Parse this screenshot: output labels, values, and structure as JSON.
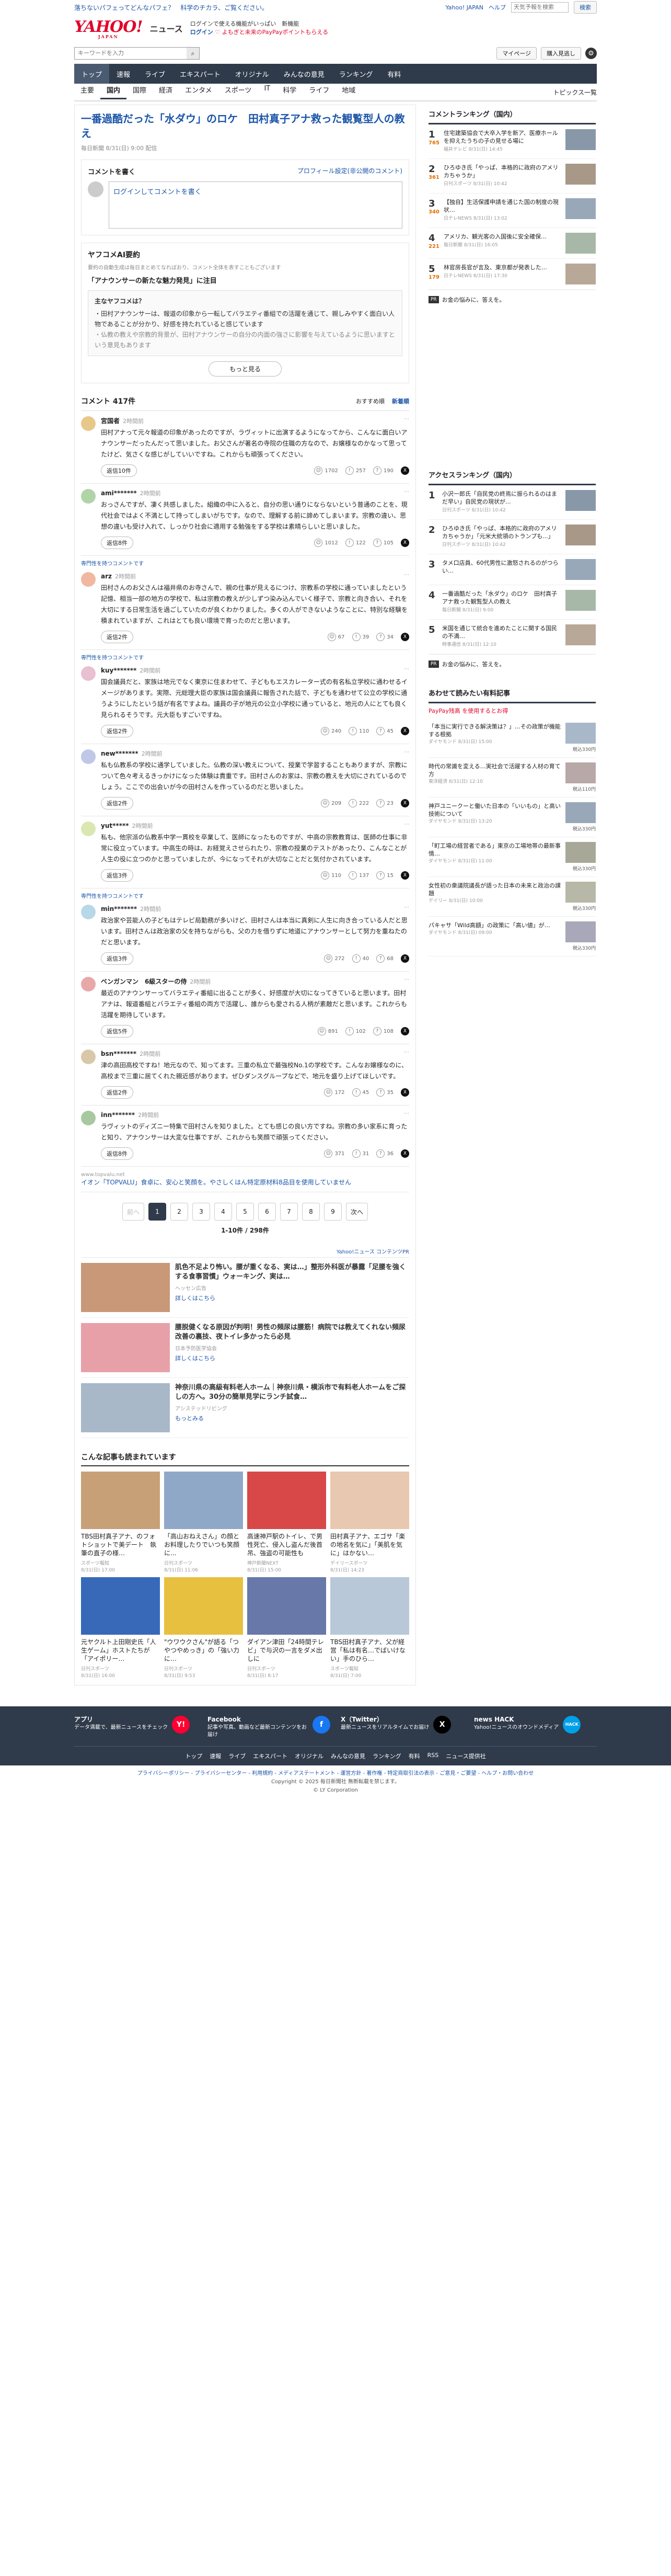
{
  "promo": {
    "left": "落ちないパフェってどんなパフェ？　科学のチカラ、ご覧ください。",
    "links": [
      "Yahoo! JAPAN",
      "ヘルプ"
    ],
    "search_placeholder": "天気予報を検索",
    "search_btn": "検索"
  },
  "header": {
    "logo": "YAHOO!",
    "logo_sub": "JAPAN",
    "news": "ニュース",
    "msg1": "ログインで使える機能がいっぱい　新機能",
    "msg2": "ログイン",
    "msg3": "♡ よもぎと未来のPayPayポイントもらえる"
  },
  "search": {
    "placeholder": "キーワードを入力",
    "mypage": "マイページ",
    "login": "購入見逃し"
  },
  "nav": [
    "トップ",
    "速報",
    "ライブ",
    "エキスパート",
    "オリジナル",
    "みんなの意見",
    "ランキング",
    "有料"
  ],
  "subnav": {
    "items": [
      "主要",
      "国内",
      "国際",
      "経済",
      "エンタメ",
      "スポーツ",
      "IT",
      "科学",
      "ライフ",
      "地域"
    ],
    "topics": "トピックス一覧"
  },
  "article": {
    "title": "一番過酷だった「水ダウ」のロケ　田村真子アナ救った観覧型人の教え",
    "meta": "毎日新聞 8/31(日) 9:00 配信"
  },
  "comment_box": {
    "title": "コメントを書く",
    "link": "プロフィール設定(非公開のコメント)",
    "input": "ログインしてコメントを書く"
  },
  "ai": {
    "title": "ヤフコメAI要約",
    "note": "要約の自動生成は毎日まとめてなればおり、コメント全体を表すこともございます",
    "quote": "「アナウンサーの新たな魅力発見」に注目",
    "q": "主なヤフコメは？",
    "p1": "・田村アナウンサーは、報道の印象から一転してバラエティ番組での活躍を通じて、親しみやすく面白い人物であることが分かり、好感を持たれていると感じています",
    "p2": "・仏教の教えや宗教的背景が、田村アナウンサーの自分の内面の強さに影響を与えているように思いますという意見もあります",
    "more": "もっと見る"
  },
  "comments_header": {
    "count": "コメント 417件",
    "sort1": "おすすめ順",
    "sort2": "新着順"
  },
  "comments": [
    {
      "user": "宮国者",
      "time": "2時間前",
      "text": "田村アナって元々報道の印象があったのですが、ラヴィットに出演するようになってから、こんなに面白いアナウンサーだったんだって思いました。お父さんが著名の寺院の住職の方なので、お嬢様なのかなって思ってたけど、気さくな感じがしていいですね。これからも頑張ってください。",
      "reply": "返信10件",
      "v1": "1702",
      "v2": "257",
      "v3": "190",
      "color": "#e8c88a"
    },
    {
      "user": "ami*******",
      "time": "2時間前",
      "text": "おっさんですが、凄く共感しました。組織の中に入ると、自分の思い通りにならないという普通のことを、現代社会ではよく不満として持ってしまいがちです。なので、理解する前に諦めてしまいます。宗教の違い、思想の違いも受け入れて、しっかり社会に適用する勉強をする学校は素晴らしいと思いました。",
      "reply": "返信8件",
      "v1": "1012",
      "v2": "122",
      "v3": "105",
      "color": "#b0d4a8"
    },
    {
      "user": "arz",
      "time": "2時間前",
      "text": "田村さんのお父さんは福井県のお寺さんで、親の仕事が見えるにつけ、宗教系の学校に通っていましたという記憶、相当一部の地方の学校で、私は宗教の教えが少しずつ染み込んでいく様子で、宗教と向き合い、それを大切にする日常生活を過ごしていたのが良くわかりました。多くの人ができないようなことに、特別な経験を積まれていますが、これはとても良い環境で育ったのだと思います。",
      "reply": "返信2件",
      "v1": "67",
      "v2": "39",
      "v3": "34",
      "color": "#f0b8a0",
      "expert": true
    },
    {
      "user": "kuy*******",
      "time": "2時間前",
      "text": "国会議員だと、家族は地元でなく東京に住まわせて、子どももエスカレーター式の有名私立学校に通わせるイメージがあります。実際、元総理大臣の家族は国会議員に報告された話で、子どもを通わせて公立の学校に通うようにしたという話が有名ですよね。議員の子が地元の公立小学校に通っていると、地元の人にとても良く見られるそうです。元大臣もすごいですね。",
      "reply": "返信2件",
      "v1": "240",
      "v2": "110",
      "v3": "45",
      "color": "#e8c0d0",
      "expert": true
    },
    {
      "user": "new*******",
      "time": "2時間前",
      "text": "私も仏教系の学校に通学していました。仏教の深い教えについて、授業で学習することもありますが、宗教について色々考えるきっかけになった体験は貴重です。田村さんのお家は、宗教の教えを大切にされているのでしょう。ここでの出会いが今の田村さんを作っているのだと思いました。",
      "reply": "返信2件",
      "v1": "209",
      "v2": "222",
      "v3": "23",
      "color": "#c0c8e8"
    },
    {
      "user": "yut*****",
      "time": "2時間前",
      "text": "私も、他宗派の仏教系中学一貫校を卒業して、医師になったものですが、中高の宗教教育は、医師の仕事に非常に役立っています。中高生の時は、お経覚えさせられたり、宗教の授業のテストがあったり、こんなことが人生の役に立つのかと思っていましたが、今になってそれが大切なことだと気付かされています。",
      "reply": "返信3件",
      "v1": "110",
      "v2": "137",
      "v3": "15",
      "color": "#d8e8b0"
    },
    {
      "user": "min*******",
      "time": "2時間前",
      "text": "政治家や芸能人の子どもはテレビ局勤務が多いけど、田村さんは本当に真剣に人生に向き合っている人だと思います。田村さんは政治家の父を持ちながらも、父の力を借りずに地道にアナウンサーとして努力を重ねたのだと思います。",
      "reply": "返信3件",
      "v1": "272",
      "v2": "40",
      "v3": "68",
      "color": "#b8d8e8",
      "expert": true
    },
    {
      "user": "ベンガンマン　6級スターの侍",
      "time": "2時間前",
      "text": "最近のアナウンサーってバラエティ番組に出ることが多く、好感度が大切になってきていると思います。田村アナは、報道番組とバラエティ番組の両方で活躍し、誰からも愛される人柄が素敵だと思います。これからも活躍を期待しています。",
      "reply": "返信5件",
      "v1": "891",
      "v2": "102",
      "v3": "108",
      "color": "#e8a8a8"
    },
    {
      "user": "bsn*******",
      "time": "2時間前",
      "text": "津の高田高校ですね！地元なので、知ってます。三重の私立で最強校No.1の学校です。こんなお嬢様なのに、高校まで三重に居てくれた親近感があります。ぜひダンスグループなどで、地元を盛り上げてほしいです。",
      "reply": "返信2件",
      "v1": "172",
      "v2": "45",
      "v3": "35",
      "color": "#d8c8a8"
    },
    {
      "user": "inn*******",
      "time": "2時間前",
      "text": "ラヴィットのディズニー特集で田村さんを知りました。とても感じの良い方ですね。宗教の多い家系に育ったと知り、アナウンサーは大変な仕事ですが、これからも笑顔で頑張ってください。",
      "reply": "返信8件",
      "v1": "371",
      "v2": "31",
      "v3": "36",
      "color": "#a8c8a0"
    }
  ],
  "expert_label": "専門性を持つコメントです",
  "ad_line": {
    "url": "www.topvalu.net",
    "text": "イオン「TOPVALU」食卓に、安心と笑顔を。やさしくはん特定原材料8品目を使用していません"
  },
  "pager": {
    "prev": "前へ",
    "pages": [
      "1",
      "2",
      "3",
      "4",
      "5",
      "6",
      "7",
      "8",
      "9"
    ],
    "next": "次へ",
    "count": "1-10件 / 298件"
  },
  "pr_title": "Yahoo!ニュース コンテンツPR",
  "prs": [
    {
      "t": "肌色不足より怖い。腰が重くなる、実は…」整形外科医が暴露「足腰を強くする食事習慣」ウォーキング、実は…",
      "s": "ヘッセン広告",
      "d": "詳しくはこちら",
      "color": "#c89878"
    },
    {
      "t": "腰脱健くなる原因が判明！男性の頻尿は腰筋！病院では教えてくれない頻尿改善の裏技、夜トイレ多かったら必見",
      "s": "日本予防医学協会",
      "d": "詳しくはこちら",
      "color": "#e8a0a8"
    },
    {
      "t": "神奈川県の高級有料老人ホーム｜神奈川県・横浜市で有料老人ホームをご探しの方へ。30分の簡単見学にランチ試食…",
      "s": "アシステッドリビング",
      "d": "もっとみる",
      "color": "#a8b8c8"
    }
  ],
  "recommend_title": "こんな記事も読まれています",
  "recs": [
    {
      "t": "TBS田村真子アナ、のフォトショットで美デート　執筆の直子の様…",
      "s": "スポーツ報知",
      "d": "8/31(日) 17:00",
      "color": "#c8a078"
    },
    {
      "t": "「高山おねえさん」の顔とお料理したりでいつも笑顔に...",
      "s": "日刊スポーツ",
      "d": "8/31(日) 11:06",
      "color": "#90a8c8"
    },
    {
      "t": "高速神戸駅のトイレ、で男性死亡、侵入し盗んだ後首吊、強盗の可能性も",
      "s": "神戸新聞NEXT",
      "d": "8/31(日) 15:00",
      "color": "#d84848"
    },
    {
      "t": "田村真子アナ、エゴサ「楽の地名を気に」「美肌を気に」はかない…",
      "s": "デイリースポーツ",
      "d": "8/31(日) 14:23",
      "color": "#e8c8b0"
    },
    {
      "t": "元ヤクルト上田剛史氏「人生ゲーム」ホストたちが「アイポリー…",
      "s": "日刊スポーツ",
      "d": "8/31(日) 16:00",
      "color": "#3868b8"
    },
    {
      "t": "\"ウワウクさん\"が語る「つやつやめっき」の「強い力に…",
      "s": "日刊スポーツ",
      "d": "8/31(日) 9:53",
      "color": "#e8c040"
    },
    {
      "t": "ダイアン津田「24時間テレビ」で与沢の一言をダメ出しに",
      "s": "日刊スポーツ",
      "d": "8/31(日) 8:17",
      "color": "#6878a8"
    },
    {
      "t": "TBS田村真子アナ、父が経営「私は有名…でばいけない」手のひら…",
      "s": "スポーツ報知",
      "d": "8/31(日) 7:00",
      "color": "#b8c8d8"
    }
  ],
  "ranking1": {
    "title": "コメントランキング（国内）",
    "items": [
      {
        "n": "1",
        "c": "765",
        "t": "住宅建築協会で大卒入学を新ア、医療ホールを抑えたうちの子の見せる場に",
        "s": "福井テレビ 8/31(日) 14:45",
        "color": "#8898a8"
      },
      {
        "n": "2",
        "c": "361",
        "t": "ひろゆき氏「やっぱ、本格的に政府のアメリカちゃうか」",
        "s": "日刊スポーツ 8/31(日) 10:42",
        "color": "#a89888"
      },
      {
        "n": "3",
        "c": "340",
        "t": "【独自】生活保護申請を通じた国の制度の現状…",
        "s": "日テレNEWS 8/31(日) 13:02",
        "color": "#98a8b8"
      },
      {
        "n": "4",
        "c": "221",
        "t": "アメリカ、観光客の入国後に安全確保…",
        "s": "毎日新聞 8/31(日) 16:05",
        "color": "#a8b8a8"
      },
      {
        "n": "5",
        "c": "179",
        "t": "林官房長官が言及、東京都が発表した…",
        "s": "日テレNEWS 8/31(日) 17:30",
        "color": "#b8a898"
      }
    ]
  },
  "side_pr": "お金の悩みに、答えを。",
  "ranking2": {
    "title": "アクセスランキング（国内）",
    "items": [
      {
        "n": "1",
        "t": "小沢一郎氏「自民党の終焉に振られるのはまだ早い」自民党の現状が...",
        "s": "日刊スポーツ 8/31(日) 10:42",
        "color": "#8898a8"
      },
      {
        "n": "2",
        "t": "ひろゆき氏「やっぱ、本格的に政府のアメリカちゃうか」「元米大統領のトランプも...」",
        "s": "日刊スポーツ 8/31(日) 10:42",
        "color": "#a89888"
      },
      {
        "n": "3",
        "t": "タメ口店員、60代男性に激怒されるのがつらい…",
        "s": "",
        "color": "#98a8b8"
      },
      {
        "n": "4",
        "t": "一番過酷だった「水ダウ」のロケ　田村真子アナ救った観覧型人の教え",
        "s": "毎日新聞 8/31(日) 9:00",
        "color": "#a8b8a8"
      },
      {
        "n": "5",
        "t": "米国を通じて統合を進めたことに関する国民の不満…",
        "s": "時事通信 8/31(日) 12:10",
        "color": "#b8a898"
      }
    ]
  },
  "side_pr2": "お金の悩みに、答えを。",
  "side_pr_title": "あわせて読みたい有料記事",
  "paypay": "PayPay残高 を使用するとお得",
  "side_paid": [
    {
      "t": "「本当に実行できる解決策は？」…その政策が機能する根拠",
      "s": "ダイヤモンド 8/31(日) 15:00",
      "p": "税込330円",
      "color": "#a8b8c8"
    },
    {
      "t": "時代の常識を変える…実社会で活躍する人材の育て方",
      "s": "東洋経済 8/31(日) 12:10",
      "p": "税込110円",
      "color": "#b8a8a8"
    },
    {
      "t": "神戸ユニークーと働いた日本の「いいもの」と高い技術について",
      "s": "ダイヤモンド 8/31(日) 13:20",
      "p": "税込330円",
      "color": "#98a8b8"
    },
    {
      "t": "「町工場の経営者である」東京の工場地帯の最新事情…",
      "s": "ダイヤモンド 8/31(日) 11:00",
      "p": "税込330円",
      "color": "#a8a898"
    },
    {
      "t": "女性初の衆議院議長が語った日本の未来と政治の課題",
      "s": "デイリー 8/31(日) 10:00",
      "p": "税込330円",
      "color": "#b8b8a8"
    },
    {
      "t": "パキャサ「Wild高額」の政策に「高い値」が…",
      "s": "ダイヤモンド 8/31(日) 09:00",
      "p": "税込330円",
      "color": "#a8a8b8"
    }
  ],
  "footer": {
    "cols": [
      {
        "title": "アプリ",
        "text": "データ満載で、最新ニュースをチェック",
        "icon": "Y!",
        "color": "#ff0033"
      },
      {
        "title": "Facebook",
        "text": "記事や写真、動画など最新コンテンツをお届け",
        "icon": "f",
        "color": "#1877f2"
      },
      {
        "title": "X（Twitter）",
        "text": "最新ニュースをリアルタイムでお届け",
        "icon": "X",
        "color": "#000"
      },
      {
        "title": "news HACK",
        "text": "Yahoo!ニュースのオウンドメディア",
        "icon": "HACK",
        "color": "#00a0e9"
      }
    ],
    "links": [
      "トップ",
      "速報",
      "ライブ",
      "エキスパート",
      "オリジナル",
      "みんなの意見",
      "ランキング",
      "有料",
      "RSS",
      "ニュース提供社"
    ],
    "bottom": "プライバシーポリシー - プライバシーセンター - 利用規約 - メディアステートメント - 運営方針 - 著作権 - 特定商取引法の表示 - ご意見・ご要望 - ヘルプ・お問い合わせ",
    "copyright": "Copyright © 2025 毎日新聞社 無断転載を禁じます。",
    "corp": "© LY Corporation"
  }
}
